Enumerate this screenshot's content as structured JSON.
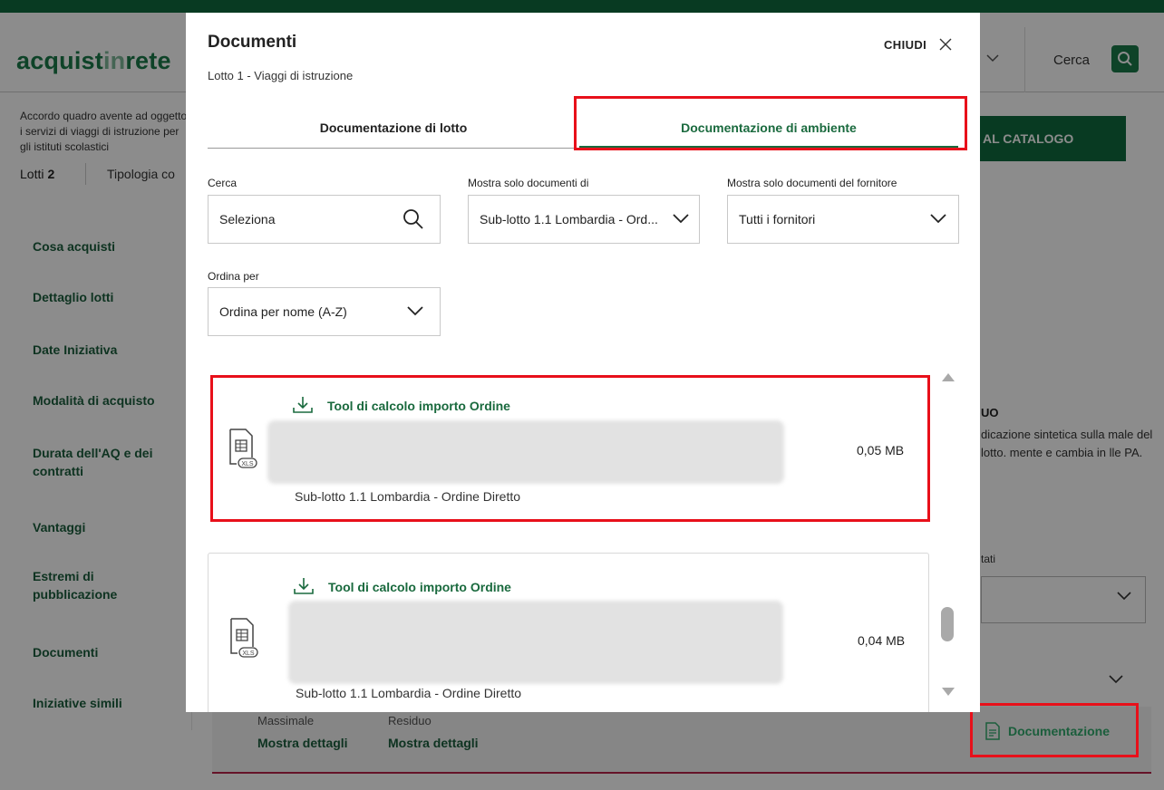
{
  "background": {
    "logo": {
      "part1": "acquist",
      "part2": "in",
      "part3": "rete"
    },
    "search_label": "Cerca",
    "intro_text": "Accordo quadro avente ad oggetto i servizi di viaggi di istruzione per gli istituti scolastici",
    "lotti_label": "Lotti",
    "lotti_count": "2",
    "tipologia_label": "Tipologia co",
    "catalog_button": "AL CATALOGO",
    "nav": [
      "Cosa acquisti",
      "Dettaglio lotti",
      "Date Iniziativa",
      "Modalità di acquisto",
      "Durata dell'AQ e dei contratti",
      "Vantaggi",
      "Estremi di pubblicazione",
      "Documenti",
      "Iniziative simili"
    ],
    "info_title": "UO",
    "info_text": "dicazione sintetica sulla male del lotto. mente e cambia in lle PA.",
    "stati_label": "tati",
    "massimale_label": "Massimale",
    "residuo_label": "Residuo",
    "mostra_dettagli_1": "Mostra dettagli",
    "mostra_dettagli_2": "Mostra dettagli",
    "documentazione_link": "Documentazione"
  },
  "modal": {
    "title": "Documenti",
    "subtitle": "Lotto 1 - Viaggi di istruzione",
    "close_label": "CHIUDI",
    "tabs": {
      "lotto": "Documentazione di lotto",
      "ambiente": "Documentazione di ambiente"
    },
    "filters": {
      "search_label": "Cerca",
      "search_value": "Seleziona",
      "show_only_label": "Mostra solo documenti di",
      "show_only_value": "Sub-lotto 1.1 Lombardia - Ord...",
      "supplier_label": "Mostra solo documenti del fornitore",
      "supplier_value": "Tutti i fornitori",
      "sort_label": "Ordina per",
      "sort_value": "Ordina per nome (A-Z)"
    },
    "documents": [
      {
        "title": "Tool di calcolo importo Ordine",
        "size": "0,05 MB",
        "sublotto": "Sub-lotto 1.1 Lombardia - Ordine Diretto",
        "filetype": "XLS"
      },
      {
        "title": "Tool di calcolo importo Ordine",
        "size": "0,04 MB",
        "sublotto": "Sub-lotto 1.1 Lombardia - Ordine Diretto",
        "filetype": "XLS"
      }
    ]
  },
  "colors": {
    "brand_green": "#1a6a3e",
    "highlight_red": "#e8101a"
  }
}
